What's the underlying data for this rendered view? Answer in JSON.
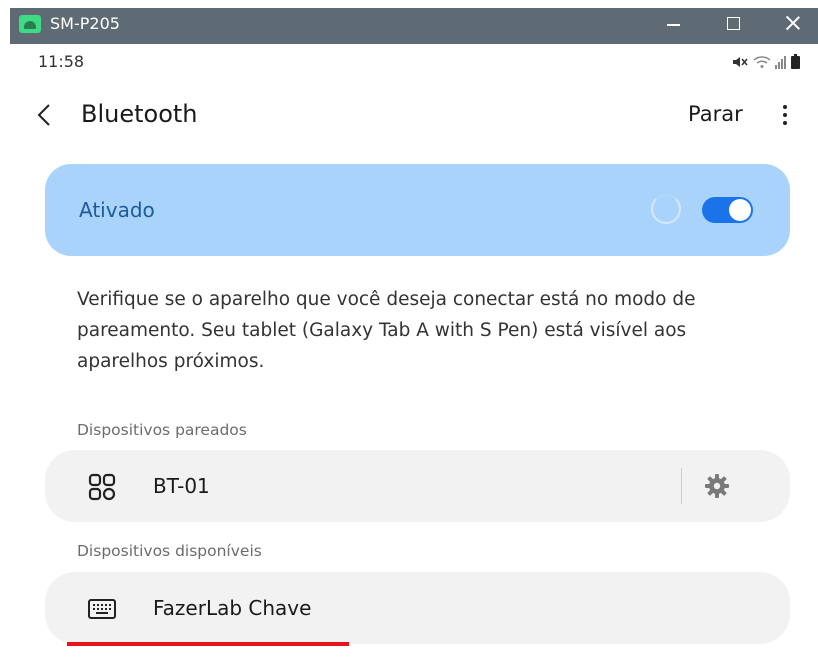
{
  "window": {
    "title": "SM-P205",
    "accent": "#5f6b74"
  },
  "status_bar": {
    "time": "11:58",
    "icons": [
      "mute-icon",
      "wifi-icon",
      "signal-icon",
      "battery-icon"
    ]
  },
  "header": {
    "title": "Bluetooth",
    "stop_label": "Parar"
  },
  "bluetooth_toggle": {
    "label": "Ativado",
    "enabled": true,
    "scanning": true,
    "card_color": "#a9d3fb",
    "switch_color": "#1a73e8"
  },
  "info": {
    "text": "Verifique se o aparelho que você deseja conectar está no modo de pareamento. Seu tablet (Galaxy Tab A with S Pen) está visível aos aparelhos próximos."
  },
  "paired": {
    "header": "Dispositivos pareados",
    "devices": [
      {
        "name": "BT-01",
        "icon": "device-generic-icon"
      }
    ]
  },
  "available": {
    "header": "Dispositivos disponíveis",
    "devices": [
      {
        "name": "FazerLab Chave",
        "icon": "keyboard-icon"
      }
    ]
  },
  "highlight_color": "#e8121a"
}
